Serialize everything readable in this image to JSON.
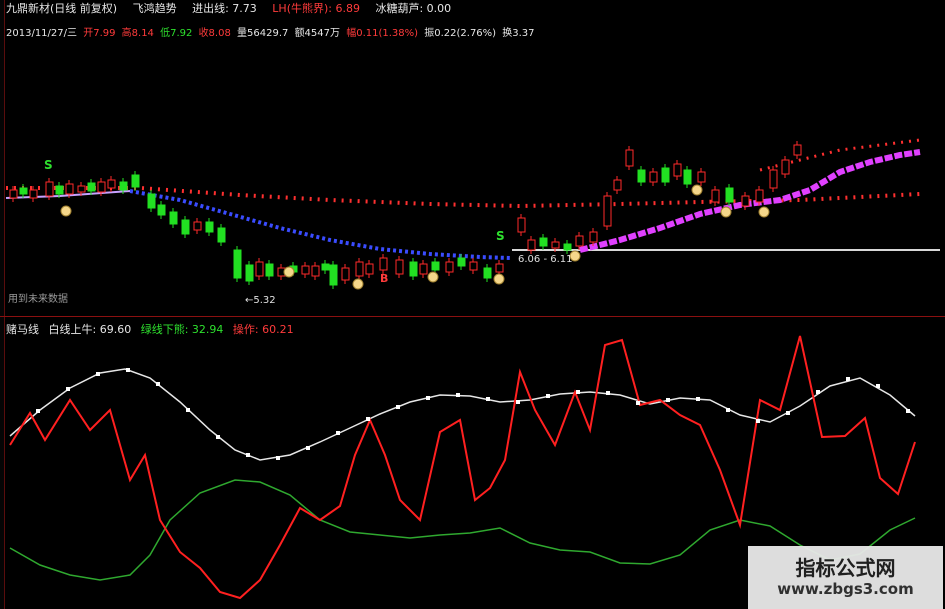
{
  "title": {
    "stock": "九鼎新材(日线 前复权)",
    "indicator": "飞鸿趋势",
    "entry_line": "进出线: 7.73",
    "lh_label": "LH(牛熊界): 6.89",
    "hulu": "冰糖葫芦: 0.00"
  },
  "ohlc": {
    "date": "2013/11/27/三",
    "open": "开7.99",
    "high": "高8.14",
    "low": "低7.92",
    "close": "收8.08",
    "volume": "量56429.7",
    "amount": "额4547万",
    "change": "幅0.11(1.38%)",
    "amplitude": "振0.22(2.76%)",
    "turnover": "换3.37"
  },
  "annotations": {
    "low_price": "←5.32",
    "range": "6.06 - 6.11",
    "future_data": "用到未来数据",
    "s_marker": "S",
    "b_marker": "B"
  },
  "indicator": {
    "name": "赌马线",
    "white_line": "白线上牛: 69.60",
    "green_line": "绿线下熊: 32.94",
    "red_line": "操作: 60.21"
  },
  "watermark": {
    "title": "指标公式网",
    "url": "www.zbgs3.com"
  },
  "colors": {
    "background": "#000000",
    "up_candle": "#ff2a2a",
    "down_candle": "#22e022",
    "red_dots": "#ff3030",
    "blue_dots": "#3a4cff",
    "magenta_line": "#e040ff",
    "white_line": "#e6e6e6",
    "green_line": "#2fa82f",
    "red_line": "#ff2020"
  }
}
